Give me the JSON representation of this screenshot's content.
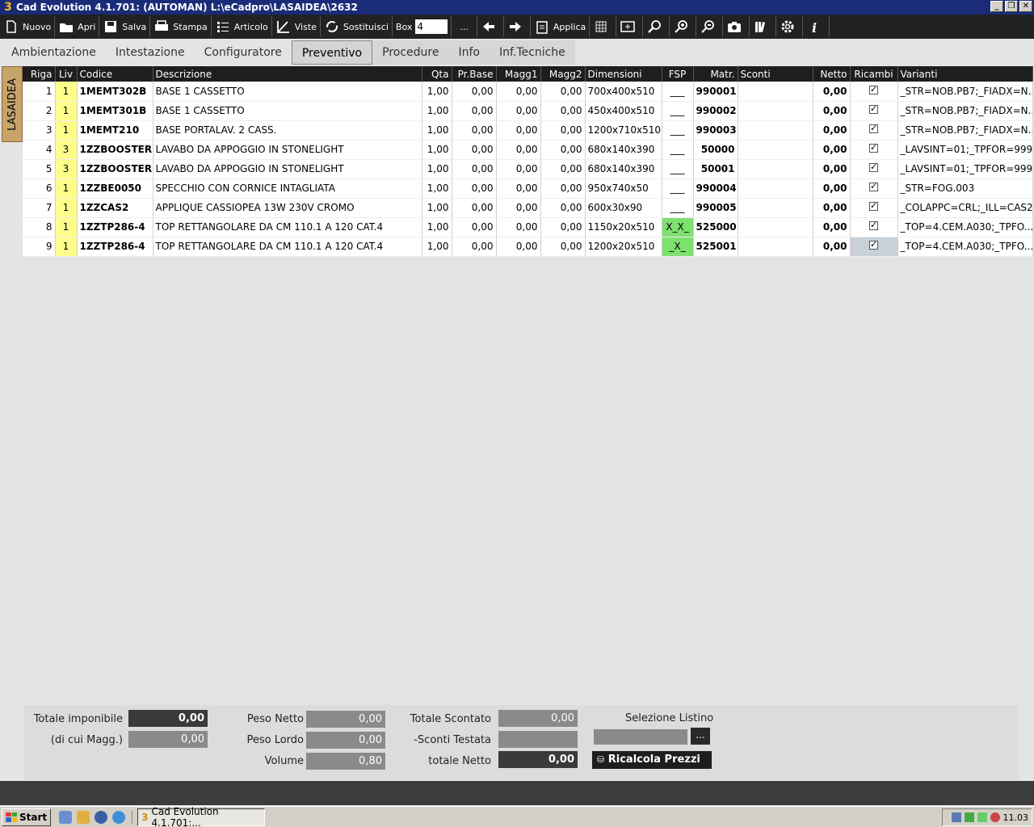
{
  "window": {
    "title": "Cad Evolution 4.1.701: (AUTOMAN)  L:\\eCadpro\\LASAIDEA\\2632",
    "app_icon": "3",
    "buttons": [
      "_",
      "❐",
      "✕"
    ]
  },
  "toolbar": {
    "nuovo": "Nuovo",
    "apri": "Apri",
    "salva": "Salva",
    "stampa": "Stampa",
    "articolo": "Articolo",
    "viste": "Viste",
    "sostituisci": "Sostituisci",
    "box_label": "Box",
    "box_value": "4",
    "ellipsis": "...",
    "applica": "Applica"
  },
  "tabs": [
    {
      "label": "Ambientazione"
    },
    {
      "label": "Intestazione"
    },
    {
      "label": "Configuratore"
    },
    {
      "label": "Preventivo",
      "active": true
    },
    {
      "label": "Procedure"
    },
    {
      "label": "Info"
    },
    {
      "label": "Inf.Tecniche"
    }
  ],
  "side_tab": "LASAIDEA",
  "table": {
    "headers": {
      "riga": "Riga",
      "liv": "Liv",
      "codice": "Codice",
      "descrizione": "Descrizione",
      "qta": "Qta",
      "prbase": "Pr.Base",
      "magg1": "Magg1",
      "magg2": "Magg2",
      "dimensioni": "Dimensioni",
      "fsp": "FSP",
      "matr": "Matr.",
      "sconti": "Sconti",
      "netto": "Netto",
      "ricambi": "Ricambi",
      "varianti": "Varianti"
    },
    "rows": [
      {
        "riga": "1",
        "liv": "1",
        "codice": "1MEMT302B",
        "descrizione": "BASE 1 CASSETTO",
        "qta": "1,00",
        "prbase": "0,00",
        "magg1": "0,00",
        "magg2": "0,00",
        "dimensioni": "700x400x510",
        "fsp": "___",
        "matr": "990001",
        "sconti": "",
        "netto": "0,00",
        "ricambi": true,
        "varianti": "_STR=NOB.PB7;_FIADX=N..."
      },
      {
        "riga": "2",
        "liv": "1",
        "codice": "1MEMT301B",
        "descrizione": "BASE 1 CASSETTO",
        "qta": "1,00",
        "prbase": "0,00",
        "magg1": "0,00",
        "magg2": "0,00",
        "dimensioni": "450x400x510",
        "fsp": "___",
        "matr": "990002",
        "sconti": "",
        "netto": "0,00",
        "ricambi": true,
        "varianti": "_STR=NOB.PB7;_FIADX=N..."
      },
      {
        "riga": "3",
        "liv": "1",
        "codice": "1MEMT210",
        "descrizione": "BASE PORTALAV. 2 CASS.",
        "qta": "1,00",
        "prbase": "0,00",
        "magg1": "0,00",
        "magg2": "0,00",
        "dimensioni": "1200x710x510",
        "fsp": "___",
        "matr": "990003",
        "sconti": "",
        "netto": "0,00",
        "ricambi": true,
        "varianti": "_STR=NOB.PB7;_FIADX=N..."
      },
      {
        "riga": "4",
        "liv": "3",
        "codice": "1ZZBOOSTER",
        "descrizione": "LAVABO  DA APPOGGIO IN STONELIGHT",
        "qta": "1,00",
        "prbase": "0,00",
        "magg1": "0,00",
        "magg2": "0,00",
        "dimensioni": "680x140x390",
        "fsp": "___",
        "matr": "50000",
        "sconti": "",
        "netto": "0,00",
        "ricambi": true,
        "varianti": "_LAVSINT=01;_TPFOR=999"
      },
      {
        "riga": "5",
        "liv": "3",
        "codice": "1ZZBOOSTER",
        "descrizione": "LAVABO  DA APPOGGIO IN STONELIGHT",
        "qta": "1,00",
        "prbase": "0,00",
        "magg1": "0,00",
        "magg2": "0,00",
        "dimensioni": "680x140x390",
        "fsp": "___",
        "matr": "50001",
        "sconti": "",
        "netto": "0,00",
        "ricambi": true,
        "varianti": "_LAVSINT=01;_TPFOR=999"
      },
      {
        "riga": "6",
        "liv": "1",
        "codice": "1ZZBE0050",
        "descrizione": "SPECCHIO CON CORNICE INTAGLIATA",
        "qta": "1,00",
        "prbase": "0,00",
        "magg1": "0,00",
        "magg2": "0,00",
        "dimensioni": "950x740x50",
        "fsp": "___",
        "matr": "990004",
        "sconti": "",
        "netto": "0,00",
        "ricambi": true,
        "varianti": "_STR=FOG.003"
      },
      {
        "riga": "7",
        "liv": "1",
        "codice": "1ZZCAS2",
        "descrizione": "APPLIQUE CASSIOPEA 13W 230V CROMO",
        "qta": "1,00",
        "prbase": "0,00",
        "magg1": "0,00",
        "magg2": "0,00",
        "dimensioni": "600x30x90",
        "fsp": "___",
        "matr": "990005",
        "sconti": "",
        "netto": "0,00",
        "ricambi": true,
        "varianti": "_COLAPPC=CRL;_ILL=CAS2"
      },
      {
        "riga": "8",
        "liv": "1",
        "codice": "1ZZTP286-4",
        "descrizione": "TOP RETTANGOLARE  DA CM 110.1 A 120  CAT.4",
        "qta": "1,00",
        "prbase": "0,00",
        "magg1": "0,00",
        "magg2": "0,00",
        "dimensioni": "1150x20x510",
        "fsp": "X_X_",
        "fsp_green": true,
        "matr": "525000",
        "sconti": "",
        "netto": "0,00",
        "ricambi": true,
        "varianti": "_TOP=4.CEM.A030;_TPFO..."
      },
      {
        "riga": "9",
        "liv": "1",
        "codice": "1ZZTP286-4",
        "descrizione": "TOP RETTANGOLARE  DA CM 110.1 A 120  CAT.4",
        "qta": "1,00",
        "prbase": "0,00",
        "magg1": "0,00",
        "magg2": "0,00",
        "dimensioni": "1200x20x510",
        "fsp": "_X_",
        "fsp_green": true,
        "matr": "525001",
        "sconti": "",
        "netto": "0,00",
        "ricambi": true,
        "ricambi_grey": true,
        "varianti": "_TOP=4.CEM.A030;_TPFO..."
      }
    ]
  },
  "totals": {
    "totale_imponibile_label": "Totale imponibile",
    "totale_imponibile": "0,00",
    "di_cui_magg_label": "(di cui Magg.)",
    "di_cui_magg": "0,00",
    "peso_netto_label": "Peso Netto",
    "peso_netto": "0,00",
    "peso_lordo_label": "Peso Lordo",
    "peso_lordo": "0,00",
    "volume_label": "Volume",
    "volume": "0,80",
    "totale_scontato_label": "Totale Scontato",
    "totale_scontato": "0,00",
    "sconti_testata_label": "-Sconti Testata",
    "sconti_testata": "",
    "totale_netto_label": "totale Netto",
    "totale_netto": "0,00",
    "selezione_listino_label": "Selezione Listino",
    "selezione_listino_btn": "...",
    "ricalcola_label": "Ricalcola Prezzi"
  },
  "taskbar": {
    "start": "Start",
    "task_label": "Cad Evolution 4.1.701:...",
    "clock": "11.03"
  }
}
